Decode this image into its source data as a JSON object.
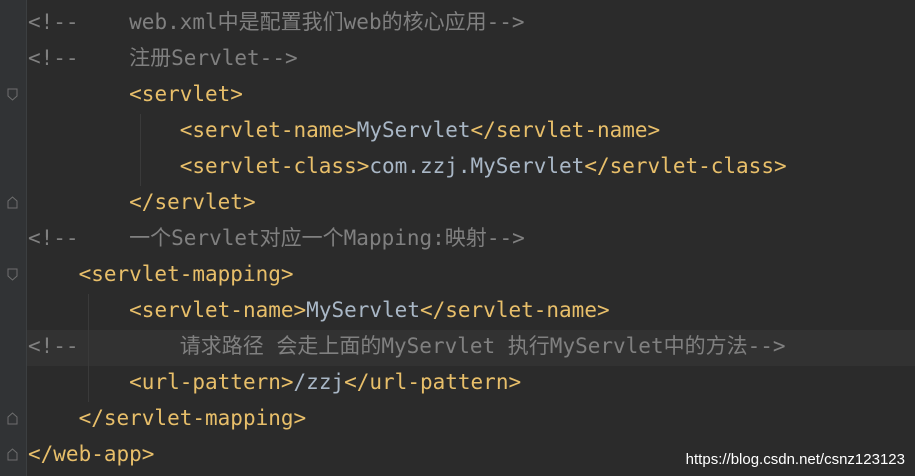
{
  "code": {
    "l1": {
      "open": "<!--",
      "gap": "    ",
      "text": "web.xml中是配置我们web的核心应用",
      "close": "-->"
    },
    "l2": {
      "open": "<!--",
      "gap": "    ",
      "text": "注册Servlet",
      "close": "-->"
    },
    "l3": {
      "indent": "        ",
      "tag": "<servlet>"
    },
    "l4": {
      "indent": "            ",
      "open": "<servlet-name>",
      "value": "MyServlet",
      "close": "</servlet-name>"
    },
    "l5": {
      "indent": "            ",
      "open": "<servlet-class>",
      "value": "com.zzj.MyServlet",
      "close": "</servlet-class>"
    },
    "l6": {
      "indent": "        ",
      "tag": "</servlet>"
    },
    "l7": {
      "open": "<!--",
      "gap": "    ",
      "text": "一个Servlet对应一个Mapping:映射",
      "close": "-->"
    },
    "l8": {
      "indent": "    ",
      "tag": "<servlet-mapping>"
    },
    "l9": {
      "indent": "        ",
      "open": "<servlet-name>",
      "value": "MyServlet",
      "close": "</servlet-name>"
    },
    "l10": {
      "open": "<!--",
      "gap": "        ",
      "text": "请求路径 会走上面的MyServlet 执行MyServlet中的方法",
      "close": "-->"
    },
    "l11": {
      "indent": "        ",
      "open": "<url-pattern>",
      "value": "/zzj",
      "close": "</url-pattern>"
    },
    "l12": {
      "indent": "    ",
      "tag": "</servlet-mapping>"
    },
    "l13": {
      "indent": "",
      "tag": "</web-app>"
    }
  },
  "watermark": "https://blog.csdn.net/csnz123123",
  "colors": {
    "background": "#2b2b2b",
    "tag": "#e8bf6a",
    "text": "#a9b7c6",
    "comment": "#808080"
  },
  "icons": [
    "fold-open-icon",
    "fold-close-icon"
  ]
}
